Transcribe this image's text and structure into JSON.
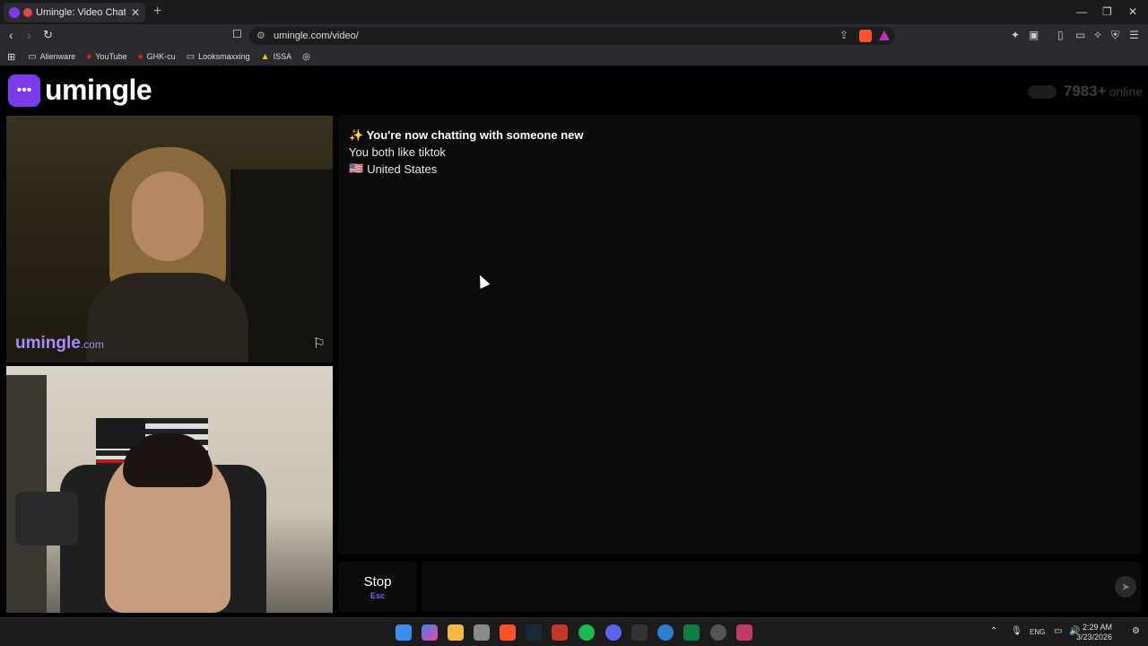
{
  "browser": {
    "tab_title": "Umingle: Video Chat with Str",
    "new_tab": "+",
    "url": "umingle.com/video/",
    "bookmarks": [
      {
        "label": "Alienware",
        "icon": "folder-icon"
      },
      {
        "label": "YouTube",
        "icon": "youtube-icon"
      },
      {
        "label": "GHK-cu",
        "icon": "youtube-icon"
      },
      {
        "label": "Looksmaxxing",
        "icon": "folder-icon"
      },
      {
        "label": "ISSA",
        "icon": "issa-icon"
      }
    ]
  },
  "site": {
    "logo_text": "umingle",
    "online_count": "7983+",
    "online_label": "online"
  },
  "remote_video": {
    "brand": "umingle",
    "brand_suffix": ".com"
  },
  "chat": {
    "messages": {
      "status": "✨ You're now chatting with someone new",
      "interests": "You both like tiktok",
      "country_flag": "🇺🇸",
      "country": "United States"
    },
    "input_placeholder": ""
  },
  "controls": {
    "stop_label": "Stop",
    "stop_key": "Esc"
  },
  "taskbar": {
    "language": "ENG",
    "time": "2:29 AM",
    "date": "3/23/2026"
  },
  "colors": {
    "brand": "#7c3aed",
    "brand_light": "#a78bfa"
  }
}
